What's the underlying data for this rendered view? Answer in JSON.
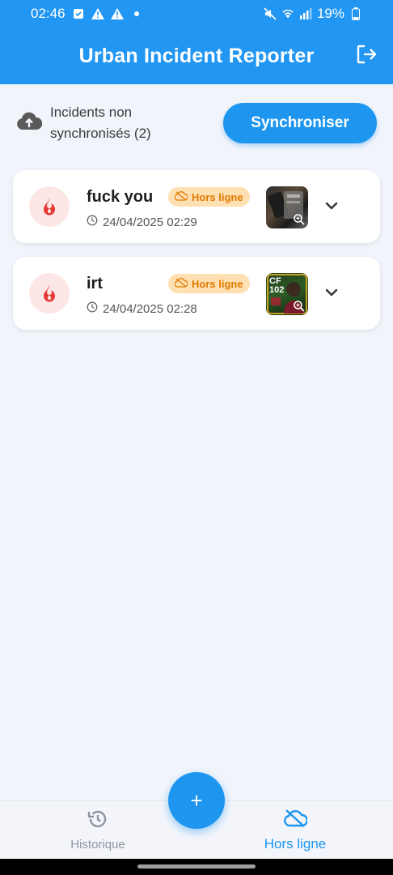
{
  "status_bar": {
    "time": "02:46",
    "battery": "19%",
    "icons": [
      "check-notification-icon",
      "warning-icon",
      "warning-icon",
      "dot-icon",
      "mute-icon",
      "wifi-icon",
      "signal-icon",
      "battery-icon"
    ]
  },
  "app_bar": {
    "title": "Urban Incident Reporter",
    "logout_icon": "logout-icon"
  },
  "sync": {
    "text": "Incidents non synchronisés (2)",
    "button_label": "Synchroniser",
    "icon": "cloud-upload-icon"
  },
  "incidents": [
    {
      "title": "fuck you",
      "badge": "Hors ligne",
      "date": "24/04/2025 02:29",
      "icon": "fire-icon"
    },
    {
      "title": "irt",
      "badge": "Hors ligne",
      "date": "24/04/2025 02:28",
      "icon": "fire-icon",
      "thumbnail_text": "CF 102"
    }
  ],
  "bottom_nav": {
    "history_label": "Historique",
    "offline_label": "Hors ligne",
    "fab_label": "+"
  },
  "colors": {
    "primary": "#2196f3",
    "accent": "#1e96f0",
    "badge_bg": "#ffe0b2",
    "badge_text": "#e07a00",
    "fire": "#e53935"
  }
}
